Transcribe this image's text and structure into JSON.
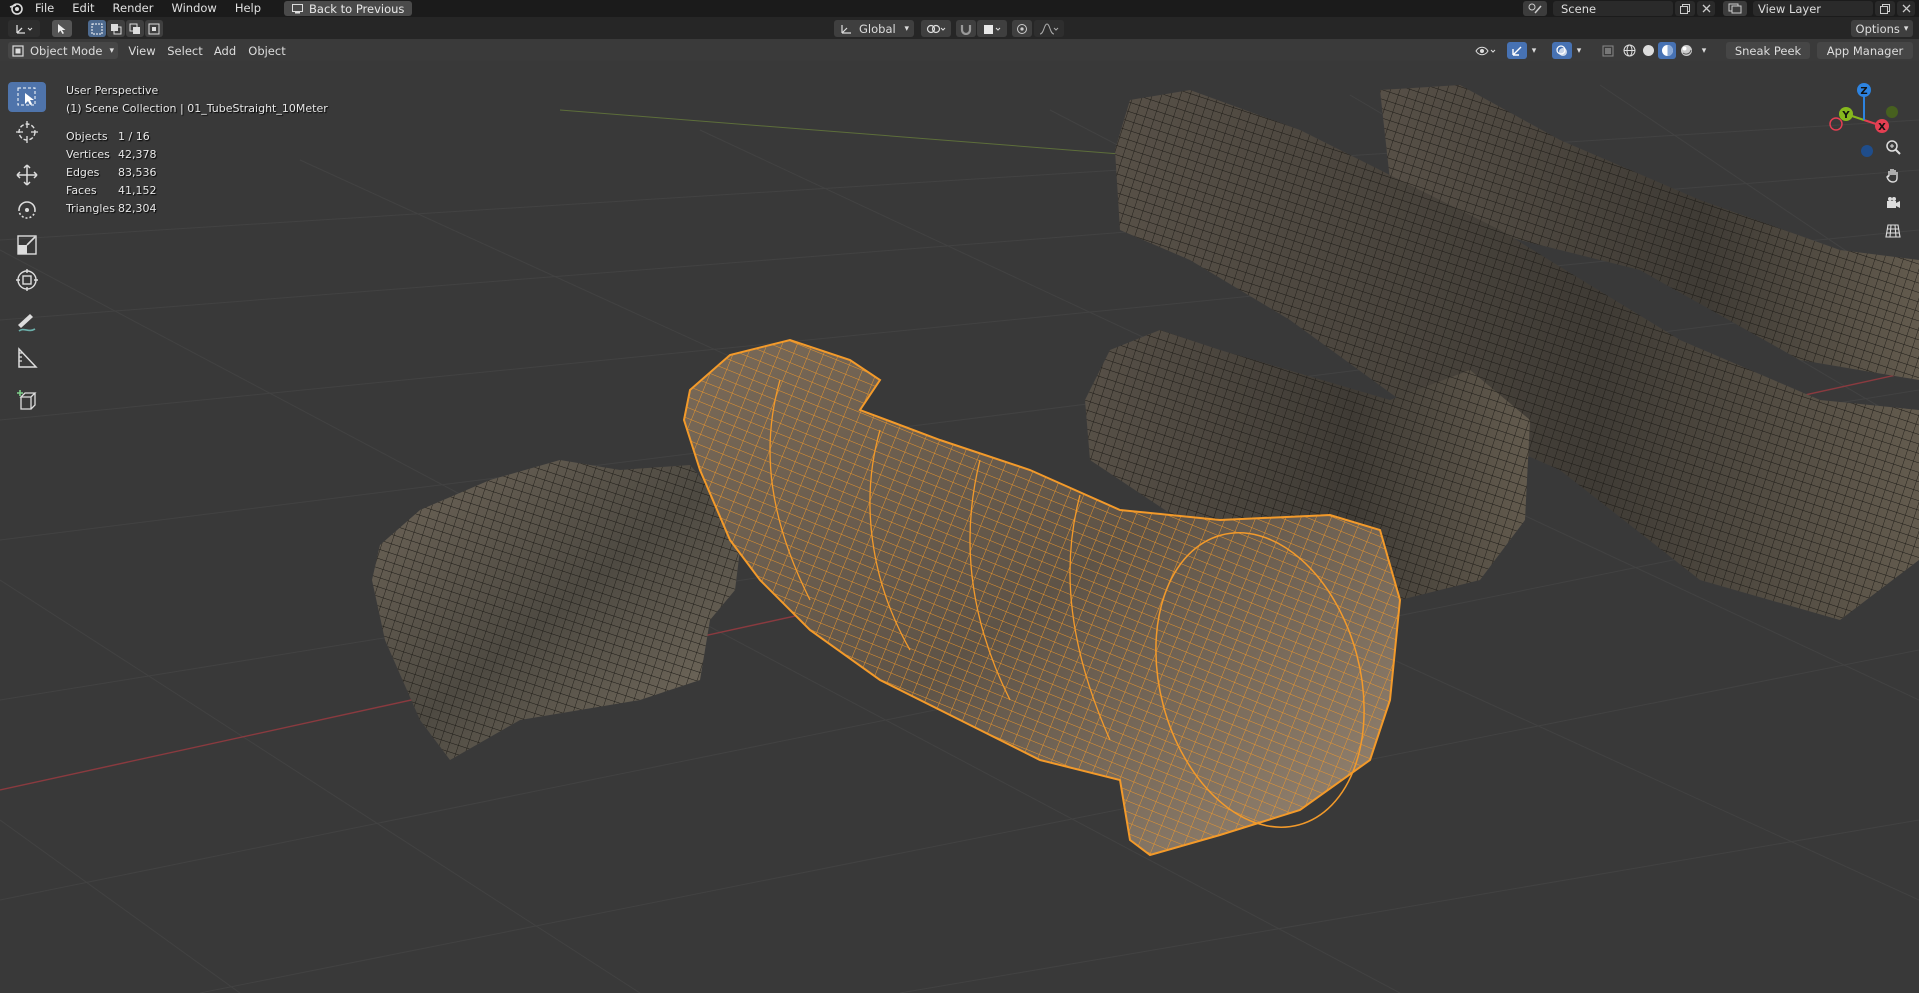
{
  "menu": {
    "items": [
      "File",
      "Edit",
      "Render",
      "Window",
      "Help"
    ],
    "back_button": "Back to Previous"
  },
  "scene": {
    "label": "Scene",
    "view_layer": "View Layer"
  },
  "tool_header": {
    "orientation": "Global",
    "options": "Options"
  },
  "viewport_header": {
    "mode": "Object Mode",
    "menus": [
      "View",
      "Select",
      "Add",
      "Object"
    ],
    "sneak_peek": "Sneak Peek",
    "app_manager": "App Manager"
  },
  "overlay": {
    "perspective": "User Perspective",
    "collection": "(1) Scene Collection | 01_TubeStraight_10Meter",
    "stats": [
      {
        "label": "Objects",
        "value": "1 / 16"
      },
      {
        "label": "Vertices",
        "value": "42,378"
      },
      {
        "label": "Edges",
        "value": "83,536"
      },
      {
        "label": "Faces",
        "value": "41,152"
      },
      {
        "label": "Triangles",
        "value": "82,304"
      }
    ]
  },
  "gizmo": {
    "x": "X",
    "y": "Y",
    "z": "Z"
  },
  "colors": {
    "selection": "#f39a2a",
    "accent": "#4772b3",
    "axis_x": "#e33f52",
    "axis_y": "#86b81d",
    "axis_z": "#2d83e0"
  },
  "icons": {
    "tools": [
      "select-box-icon",
      "cursor-icon",
      "move-icon",
      "rotate-icon",
      "scale-icon",
      "transform-icon",
      "annotate-icon",
      "measure-icon",
      "add-cube-icon"
    ],
    "nav": [
      "zoom-icon",
      "hand-icon",
      "camera-icon",
      "grid-icon"
    ]
  }
}
